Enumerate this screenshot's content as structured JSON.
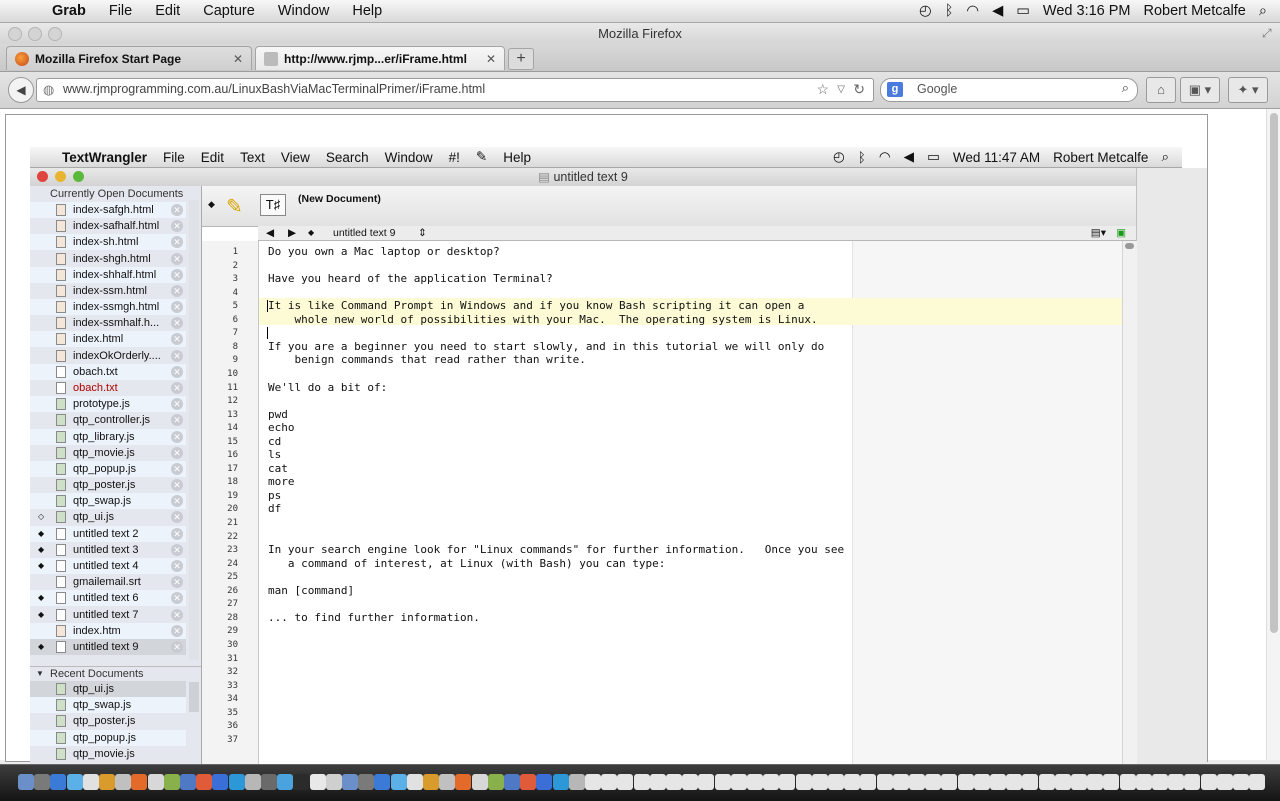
{
  "mac_menubar": {
    "app": "Grab",
    "items": [
      "File",
      "Edit",
      "Capture",
      "Window",
      "Help"
    ],
    "clock": "Wed 3:16 PM",
    "user": "Robert Metcalfe"
  },
  "firefox": {
    "window_title": "Mozilla Firefox",
    "tabs": [
      {
        "label": "Mozilla Firefox Start Page"
      },
      {
        "label": "http://www.rjmp...er/iFrame.html"
      }
    ],
    "url": "www.rjmprogramming.com.au/LinuxBashViaMacTerminalPrimer/iFrame.html",
    "search_placeholder": "Google",
    "search_engine_icon": "google-icon"
  },
  "inner_menubar": {
    "app": "TextWrangler",
    "items": [
      "File",
      "Edit",
      "Text",
      "View",
      "Search",
      "Window",
      "#!",
      "Help"
    ],
    "script_icon": "script-icon",
    "clock": "Wed 11:47 AM",
    "user": "Robert Metcalfe"
  },
  "textwrangler": {
    "window_title": "untitled text 9",
    "toolbar_label": "(New Document)",
    "nav_doc": "untitled text 9",
    "open_docs_header": "Currently Open Documents",
    "open_docs": [
      {
        "name": "index-safgh.html",
        "type": "html",
        "mark": ""
      },
      {
        "name": "index-safhalf.html",
        "type": "html",
        "mark": ""
      },
      {
        "name": "index-sh.html",
        "type": "html",
        "mark": ""
      },
      {
        "name": "index-shgh.html",
        "type": "html",
        "mark": ""
      },
      {
        "name": "index-shhalf.html",
        "type": "html",
        "mark": ""
      },
      {
        "name": "index-ssm.html",
        "type": "html",
        "mark": ""
      },
      {
        "name": "index-ssmgh.html",
        "type": "html",
        "mark": ""
      },
      {
        "name": "index-ssmhalf.h...",
        "type": "html",
        "mark": ""
      },
      {
        "name": "index.html",
        "type": "html",
        "mark": ""
      },
      {
        "name": "indexOkOrderly....",
        "type": "html",
        "mark": ""
      },
      {
        "name": "obach.txt",
        "type": "txt",
        "mark": ""
      },
      {
        "name": "obach.txt",
        "type": "txt",
        "mark": "",
        "red": true
      },
      {
        "name": "prototype.js",
        "type": "js",
        "mark": ""
      },
      {
        "name": "qtp_controller.js",
        "type": "js",
        "mark": ""
      },
      {
        "name": "qtp_library.js",
        "type": "js",
        "mark": ""
      },
      {
        "name": "qtp_movie.js",
        "type": "js",
        "mark": ""
      },
      {
        "name": "qtp_popup.js",
        "type": "js",
        "mark": ""
      },
      {
        "name": "qtp_poster.js",
        "type": "js",
        "mark": ""
      },
      {
        "name": "qtp_swap.js",
        "type": "js",
        "mark": ""
      },
      {
        "name": "qtp_ui.js",
        "type": "js",
        "mark": "◇"
      },
      {
        "name": "untitled text 2",
        "type": "txt",
        "mark": "◆"
      },
      {
        "name": "untitled text 3",
        "type": "txt",
        "mark": "◆"
      },
      {
        "name": "untitled text 4",
        "type": "txt",
        "mark": "◆"
      },
      {
        "name": "gmailemail.srt",
        "type": "txt",
        "mark": ""
      },
      {
        "name": "untitled text 6",
        "type": "txt",
        "mark": "◆"
      },
      {
        "name": "untitled text 7",
        "type": "txt",
        "mark": "◆"
      },
      {
        "name": "index.htm",
        "type": "html",
        "mark": ""
      },
      {
        "name": "untitled text 9",
        "type": "txt",
        "mark": "◆",
        "selected": true
      }
    ],
    "recent_docs_header": "Recent Documents",
    "recent_docs": [
      {
        "name": "qtp_ui.js"
      },
      {
        "name": "qtp_swap.js"
      },
      {
        "name": "qtp_poster.js"
      },
      {
        "name": "qtp_popup.js"
      },
      {
        "name": "qtp_movie.js"
      }
    ],
    "line_count": 37,
    "lines": [
      {
        "n": 1,
        "text": "Do you own a Mac laptop or desktop?"
      },
      {
        "n": 3,
        "text": "Have you heard of the application Terminal?"
      },
      {
        "n": 5,
        "text": "It is like Command Prompt in Windows and if you know Bash scripting it can open a"
      },
      {
        "n": 6,
        "text": "    whole new world of possibilities with your Mac.  The operating system is Linux."
      },
      {
        "n": 8,
        "text": "If you are a beginner you need to start slowly, and in this tutorial we will only do"
      },
      {
        "n": 9,
        "text": "    benign commands that read rather than write."
      },
      {
        "n": 11,
        "text": "We'll do a bit of:"
      },
      {
        "n": 13,
        "text": "pwd"
      },
      {
        "n": 14,
        "text": "echo"
      },
      {
        "n": 15,
        "text": "cd"
      },
      {
        "n": 16,
        "text": "ls"
      },
      {
        "n": 17,
        "text": "cat"
      },
      {
        "n": 18,
        "text": "more"
      },
      {
        "n": 19,
        "text": "ps"
      },
      {
        "n": 20,
        "text": "df"
      },
      {
        "n": 23,
        "text": "In your search engine look for \"Linux commands\" for further information.   Once you see"
      },
      {
        "n": 24,
        "text": "   a command of interest, at Linux (with Bash) you can type:"
      },
      {
        "n": 26,
        "text": "man [command]"
      },
      {
        "n": 28,
        "text": "... to find further information."
      }
    ]
  }
}
